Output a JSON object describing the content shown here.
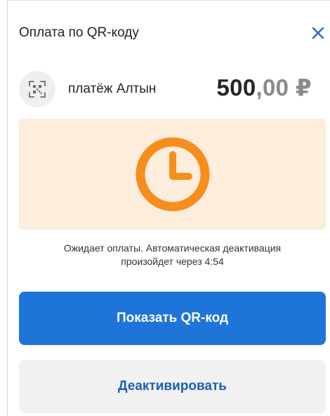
{
  "dialog": {
    "title": "Оплата по QR-коду",
    "close_icon": "close-icon"
  },
  "payment": {
    "merchant": "платёж Алтын",
    "amount_int": "500",
    "amount_frac": ",00",
    "currency": "₽",
    "icon": "qr-scan-icon"
  },
  "status": {
    "icon": "clock-icon",
    "text_line1": "Ожидает оплаты. Автоматическая деактивация",
    "text_line2": "произойдет через 4:54"
  },
  "buttons": {
    "show_qr": "Показать QR-код",
    "deactivate": "Деактивировать"
  },
  "colors": {
    "primary": "#1f74d9",
    "status_bg": "#fdeddc",
    "clock": "#f68e1e",
    "close": "#2f6fc4"
  }
}
